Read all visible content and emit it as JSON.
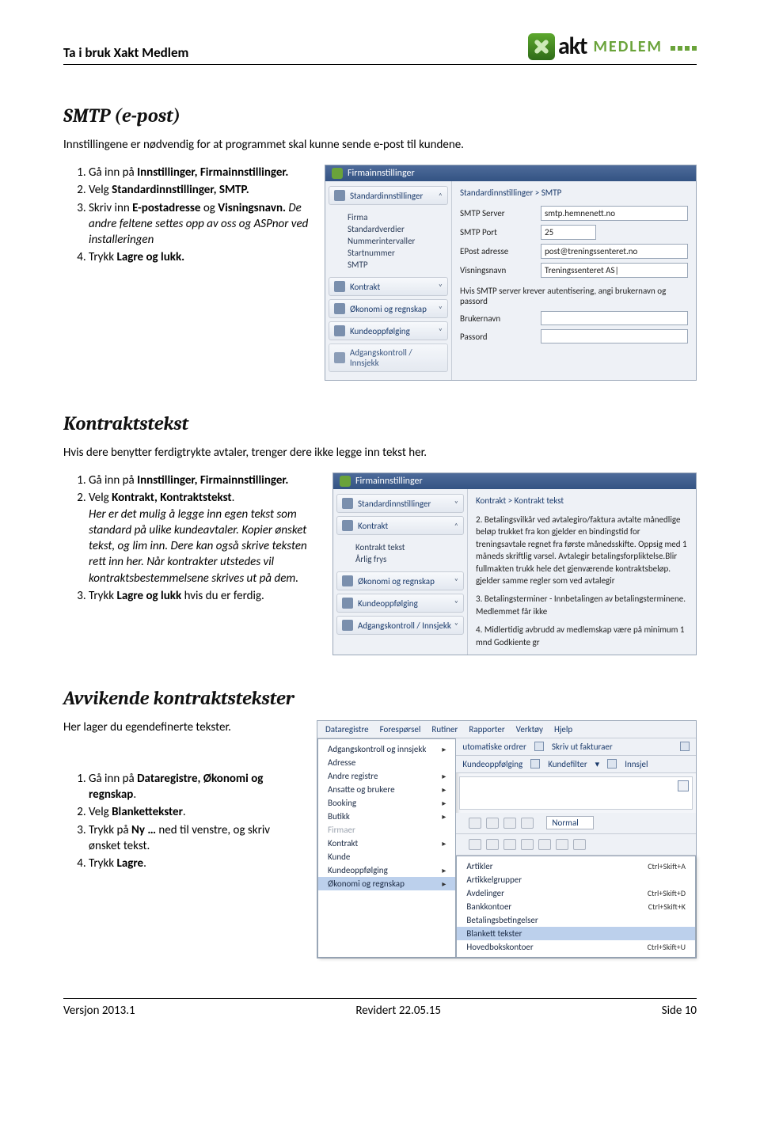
{
  "header": {
    "title": "Ta i bruk Xakt Medlem",
    "logo_akt": "akt",
    "logo_medlem": "MEDLEM"
  },
  "section1": {
    "heading": "SMTP (e-post)",
    "intro": "Innstillingene er nødvendig for at programmet skal kunne sende e-post til kundene.",
    "steps": {
      "s1a": "Gå inn på ",
      "s1b": "Innstillinger, Firmainnstillinger.",
      "s2a": "Velg ",
      "s2b": "Standardinnstillinger, SMTP.",
      "s3a": "Skriv inn ",
      "s3b": "E-postadresse",
      "s3c": " og ",
      "s3d": "Visningsnavn.",
      "s3e": " De andre feltene settes opp av oss og ASPnor ved installeringen",
      "s4a": "Trykk ",
      "s4b": "Lagre og lukk."
    },
    "shot": {
      "title": "Firmainnstillinger",
      "nav": {
        "std": "Standardinnstillinger",
        "sub": [
          "Firma",
          "Standardverdier",
          "Nummerintervaller",
          "Startnummer",
          "SMTP"
        ],
        "kontrakt": "Kontrakt",
        "okon": "Økonomi og regnskap",
        "kunde": "Kundeoppfølging",
        "adg": "Adgangskontroll / Innsjekk"
      },
      "crumb": "Standardinnstillinger > SMTP",
      "labels": {
        "server": "SMTP Server",
        "port": "SMTP Port",
        "epost": "EPost adresse",
        "visn": "Visningsnavn",
        "bruker": "Brukernavn",
        "pw": "Passord"
      },
      "values": {
        "server": "smtp.hemnenett.no",
        "port": "25",
        "epost": "post@treningssenteret.no",
        "visn": "Treningssenteret AS|"
      },
      "note": "Hvis SMTP server krever autentisering, angi brukernavn og passord"
    }
  },
  "section2": {
    "heading": "Kontraktstekst",
    "intro": "Hvis dere benytter ferdigtrykte avtaler, trenger dere ikke legge inn tekst her.",
    "steps": {
      "s1a": "Gå inn på ",
      "s1b": "Innstillinger, Firmainnstillinger.",
      "s2a": "Velg ",
      "s2b": "Kontrakt, Kontraktstekst",
      "s2c": ".",
      "s2_desc": "Her er det mulig å legge inn egen tekst som standard på ulike kundeavtaler. Kopier ønsket tekst, og lim inn. Dere kan også skrive teksten rett inn her. Når kontrakter utstedes vil kontraktsbestemmelsene skrives ut på dem.",
      "s3a": "Trykk ",
      "s3b": "Lagre og lukk",
      "s3c": " hvis du er ferdig."
    },
    "shot": {
      "title": "Firmainnstillinger",
      "nav": {
        "std": "Standardinnstillinger",
        "kontrakt": "Kontrakt",
        "sub": [
          "Kontrakt tekst",
          "Årlig frys"
        ],
        "okon": "Økonomi og regnskap",
        "kunde": "Kundeoppfølging",
        "adg": "Adgangskontroll / Innsjekk"
      },
      "crumb": "Kontrakt > Kontrakt tekst",
      "body": [
        "2. Betalingsvilkår ved avtalegiro/faktura avtalte månedlige beløp trukket fra kon gjelder en bindingstid for treningsavtale regnet fra første månedsskifte. Oppsig med 1 måneds skriftlig varsel. Avtalegir betalingsforpliktelse.Blir fullmakten trukk hele det gjenværende kontraktsbeløp. gjelder samme regler som ved avtalegir",
        "3. Betalingsterminer - Innbetalingen av betalingsterminene. Medlemmet får ikke",
        "4. Midlertidig avbrudd av medlemskap være på minimum 1 mnd  Godkiente gr"
      ]
    }
  },
  "section3": {
    "heading": "Avvikende kontraktstekster",
    "intro": "Her lager du egendefinerte tekster.",
    "steps": {
      "s1a": "Gå inn på ",
      "s1b": "Dataregistre, Økonomi og regnskap",
      "s1c": ".",
      "s2a": "Velg ",
      "s2b": "Blankettekster",
      "s2c": ".",
      "s3a": " Trykk på ",
      "s3b": "Ny …",
      "s3c": " ned til venstre, og skriv ønsket tekst.",
      "s4a": "Trykk ",
      "s4b": "Lagre",
      "s4c": "."
    },
    "shot": {
      "menu_top": [
        "Dataregistre",
        "Forespørsel",
        "Rutiner",
        "Rapporter",
        "Verktøy",
        "Hjelp"
      ],
      "toolbar_left": [
        "Adgangskontroll og innsjekk",
        "Adresse",
        "Andre registre",
        "Ansatte og brukere",
        "Booking",
        "Butikk",
        "Firmaer",
        "Kontrakt",
        "Kunde",
        "Kundeoppfølging",
        "Økonomi og regnskap"
      ],
      "toolbar_top": [
        "utomatiske ordrer",
        "Skriv ut fakturaer"
      ],
      "toolbar_top2": [
        "Kundeoppfølging",
        "Kundefilter",
        "Innsjel"
      ],
      "sub_items": [
        {
          "label": "Artikler",
          "kb": "Ctrl+Skift+A"
        },
        {
          "label": "Artikkelgrupper",
          "kb": ""
        },
        {
          "label": "Avdelinger",
          "kb": "Ctrl+Skift+D"
        },
        {
          "label": "Bankkontoer",
          "kb": "Ctrl+Skift+K"
        },
        {
          "label": "Betalingsbetingelser",
          "kb": ""
        },
        {
          "label": "Blankett tekster",
          "kb": ""
        },
        {
          "label": "Hovedbokskontoer",
          "kb": "Ctrl+Skift+U"
        }
      ],
      "combo": "Normal"
    }
  },
  "footer": {
    "left": "Versjon 2013.1",
    "mid": "Revidert 22.05.15",
    "right": "Side 10"
  }
}
